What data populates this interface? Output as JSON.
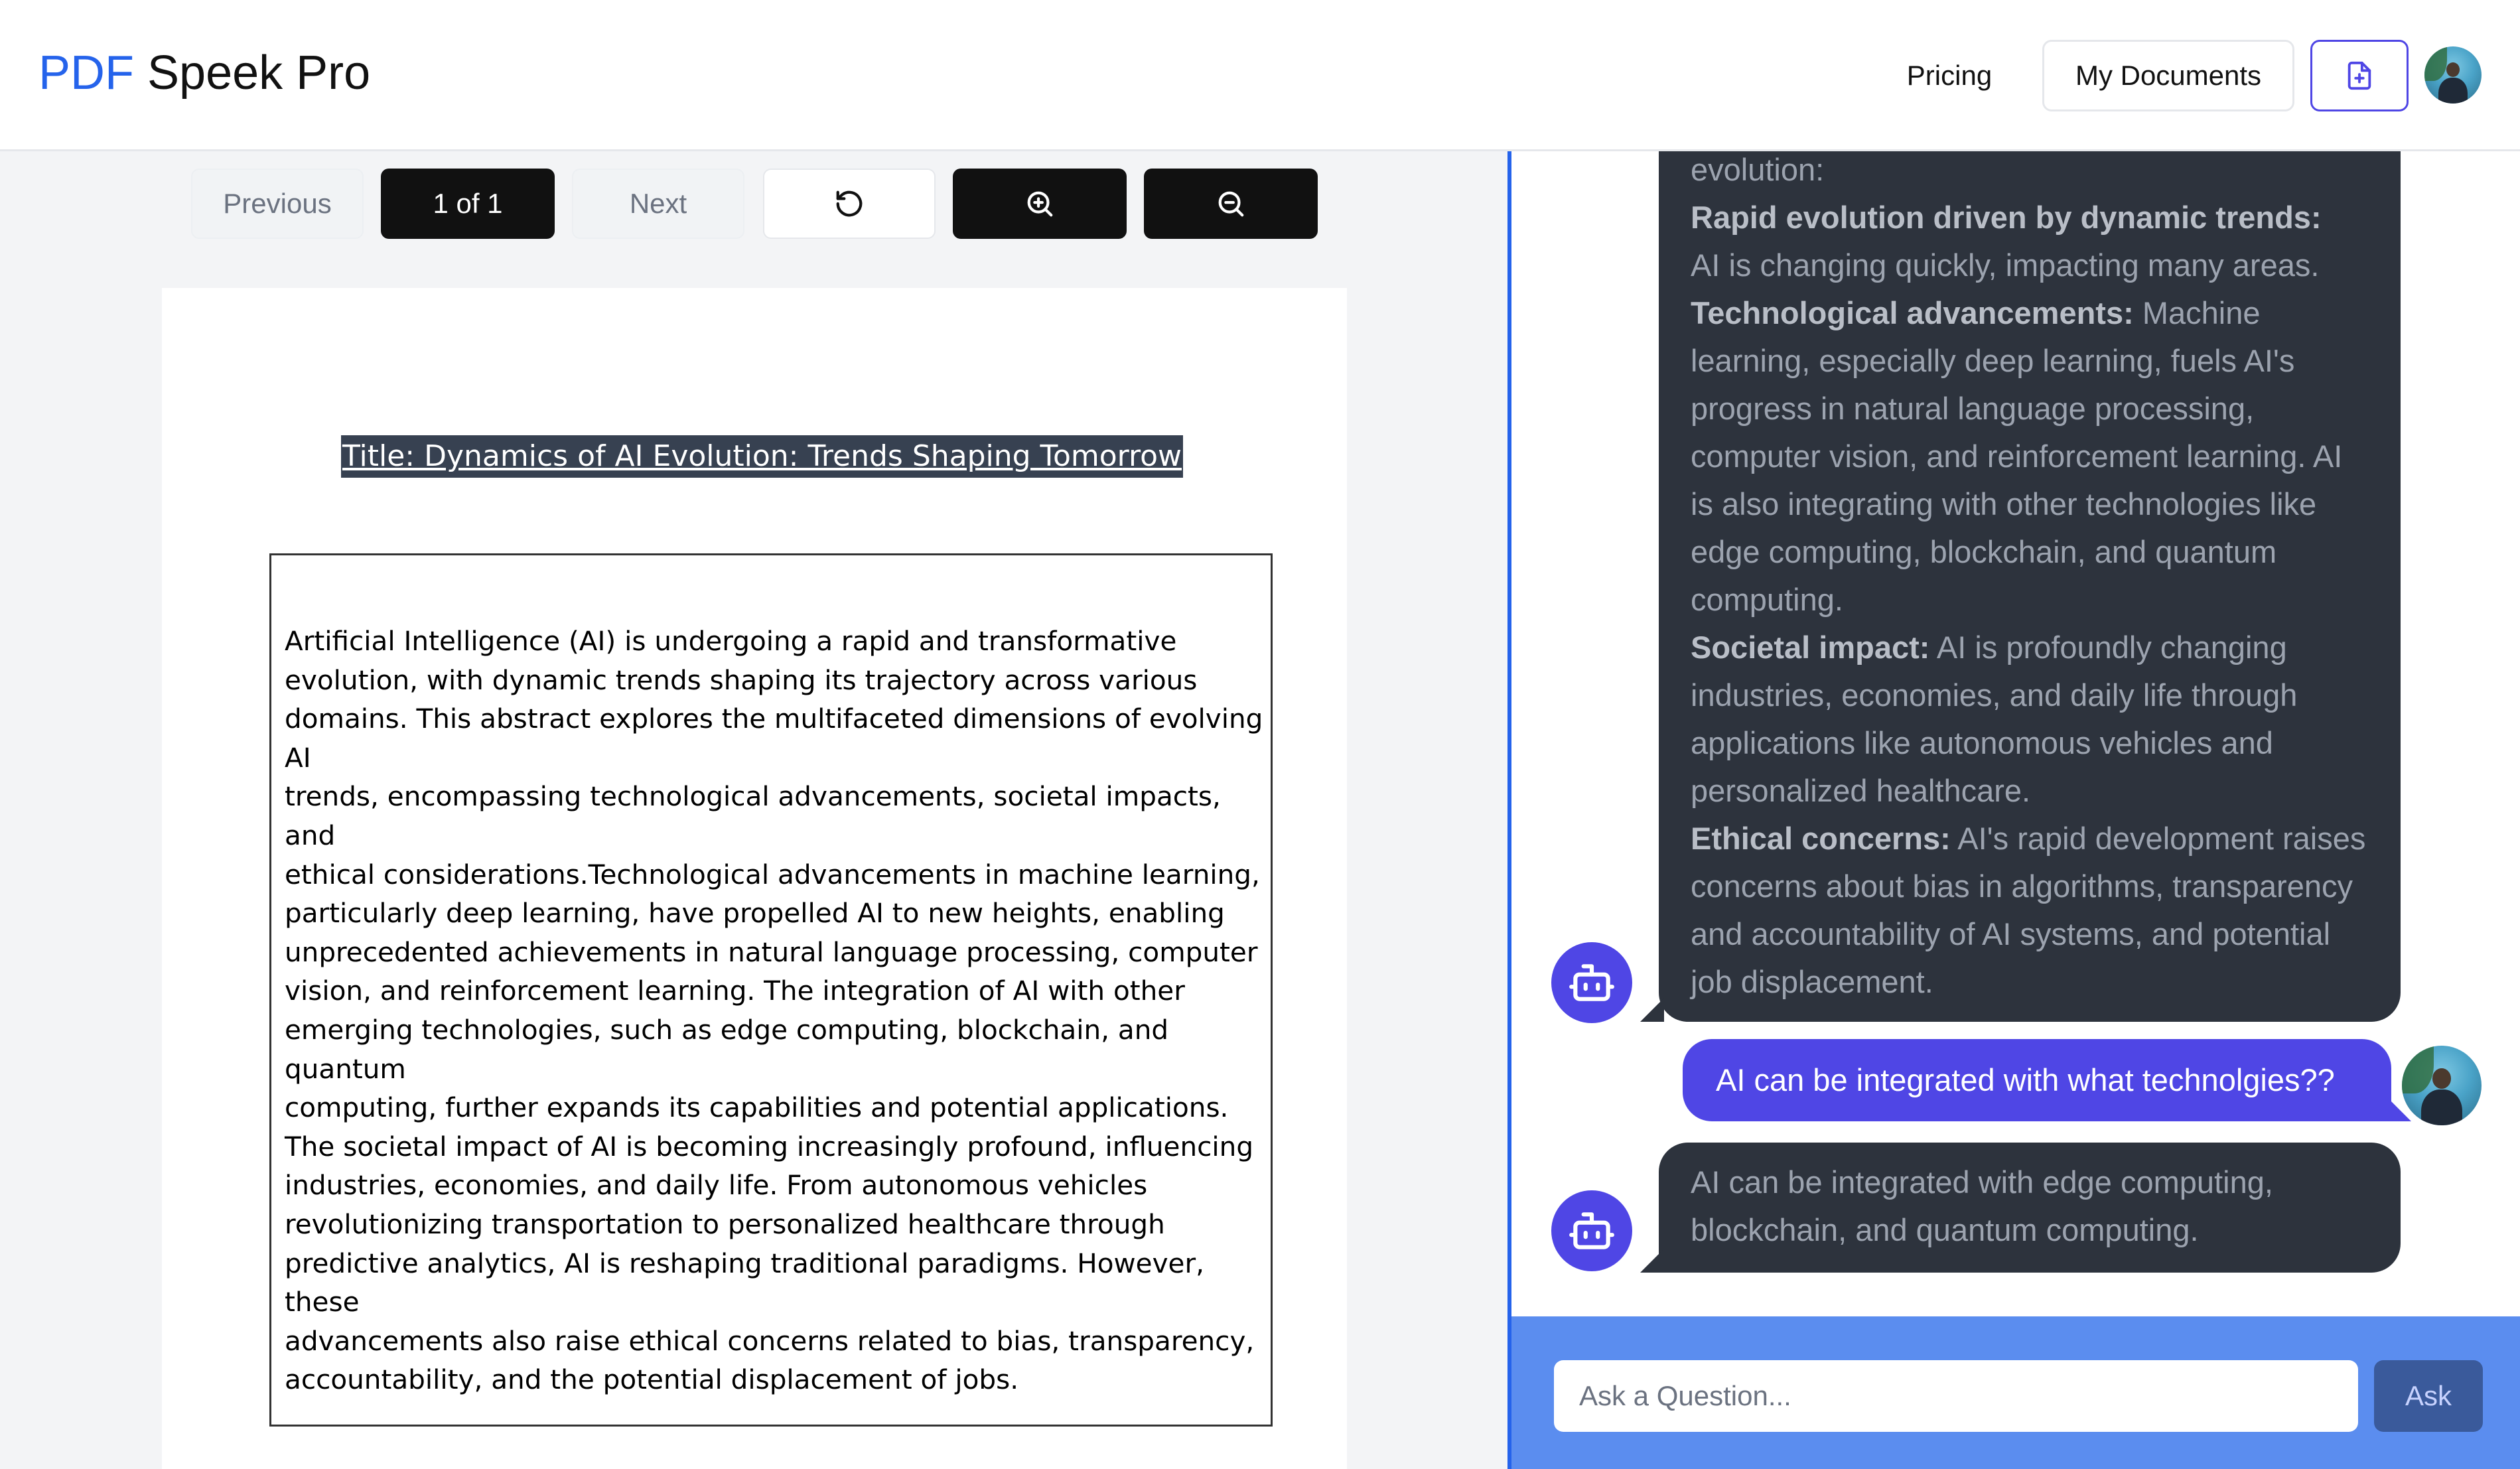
{
  "header": {
    "brand_first": "PDF",
    "brand_rest": " Speek Pro",
    "pricing_label": "Pricing",
    "documents_label": "My Documents",
    "upload_icon": "file-plus-icon",
    "avatar": "user-avatar"
  },
  "viewer": {
    "previous_label": "Previous",
    "page_indicator": "1 of 1",
    "next_label": "Next",
    "rotate_icon": "rotate-icon",
    "zoom_in_icon": "zoom-in-icon",
    "zoom_out_icon": "zoom-out-icon",
    "doc_title": "Title: Dynamics of AI Evolution: Trends Shaping Tomorrow",
    "abstract": "Artificial Intelligence (AI) is undergoing a rapid and transformative\nevolution, with dynamic trends shaping its trajectory across various\ndomains. This abstract explores the multifaceted dimensions of evolving AI\ntrends, encompassing technological advancements, societal impacts, and\nethical considerations.Technological advancements in machine learning,\nparticularly deep learning, have propelled AI to new heights, enabling\nunprecedented achievements in natural language processing, computer\nvision, and reinforcement learning. The integration of AI with other\nemerging technologies, such as edge computing, blockchain, and quantum\ncomputing, further expands its capabilities and potential applications.\nThe societal impact of AI is becoming increasingly profound, influencing\nindustries, economies, and daily life. From autonomous vehicles\nrevolutionizing transportation to personalized healthcare through\npredictive analytics, AI is reshaping traditional paradigms. However, these\nadvancements also raise ethical concerns related to bias, transparency,\naccountability, and the potential displacement of jobs."
  },
  "chat": {
    "messages": [
      {
        "role": "bot",
        "intro": "evolution:",
        "points": [
          {
            "heading": "Rapid evolution driven by dynamic trends:",
            "text": "AI is changing quickly, impacting many areas."
          },
          {
            "heading": "Technological advancements:",
            "text": "Machine learning, especially deep learning, fuels AI's progress in natural language processing, computer vision, and reinforcement learning. AI is also integrating with other technologies like edge computing, blockchain, and quantum computing."
          },
          {
            "heading": "Societal impact:",
            "text": "AI is profoundly changing industries, economies, and daily life through applications like autonomous vehicles and personalized healthcare."
          },
          {
            "heading": "Ethical concerns:",
            "text": "AI's rapid development raises concerns about bias in algorithms, transparency and accountability of AI systems, and potential job displacement."
          }
        ]
      },
      {
        "role": "user",
        "text": "AI can be integrated with what technolgies??"
      },
      {
        "role": "bot",
        "text": "AI can be integrated with edge computing, blockchain, and quantum computing."
      }
    ],
    "bot_icon": "robot-icon",
    "input_placeholder": "Ask a Question...",
    "ask_label": "Ask"
  }
}
